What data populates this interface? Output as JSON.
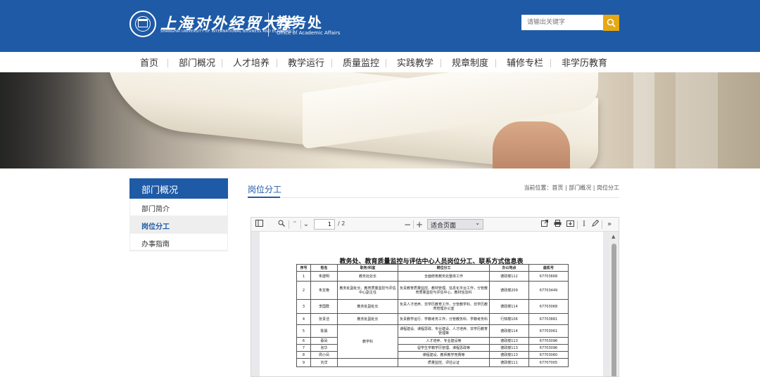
{
  "header": {
    "university_cn": "上海对外经贸大学",
    "university_en": "SHANGHAI UNIVERSITY OF INTERNATIONAL BUSINESS AND ECONOMICS",
    "office_cn": "教务处",
    "office_en": "Office of Academic Affairs",
    "search_placeholder": "请输出关键字"
  },
  "nav": [
    "首页",
    "部门概况",
    "人才培养",
    "教学运行",
    "质量监控",
    "实践教学",
    "规章制度",
    "辅修专栏",
    "非学历教育"
  ],
  "sidebar": {
    "title": "部门概况",
    "items": [
      {
        "label": "部门简介",
        "active": false
      },
      {
        "label": "岗位分工",
        "active": true
      },
      {
        "label": "办事指南",
        "active": false
      }
    ]
  },
  "content": {
    "title": "岗位分工",
    "breadcrumb": "当前位置：首页 | 部门概况 | 岗位分工"
  },
  "pdf_viewer": {
    "current_page": "1",
    "total_pages": "/ 2",
    "zoom": "适合页面",
    "document": {
      "title": "教务处、教育质量监控与评估中心人员岗位分工、联系方式信息表",
      "headers": [
        "序号",
        "姓名",
        "职务/科室",
        "岗位分工",
        "办公地点",
        "座机号"
      ],
      "rows": [
        [
          "1",
          "朱建明",
          "教务处处长",
          "全面统筹教务处整体工作",
          "德政楼112",
          "67703668"
        ],
        [
          "2",
          "朱龙艳",
          "教务处副处长、教育质量监控与评估中心副主任",
          "负责教育质量监控、教材管理、信息化平台工作，分管教育质量监控与评估中心、教材信息科",
          "德政楼209",
          "67703449"
        ],
        [
          "3",
          "李国群",
          "教务处副处长",
          "负责人才培养、非学历教育工作，分管教学科、非学历教育管理办公室",
          "德政楼114",
          "67703068"
        ],
        [
          "4",
          "张贵洁",
          "教务处副处长",
          "负责教学运行、学籍考务工作，分管教务科、学籍考务科",
          "行知楼106",
          "67703881"
        ],
        [
          "5",
          "陈晨",
          "教学科",
          "课程建设、课程思政、专业建设、人才培养、非学历教育管理等",
          "德政楼114",
          "67703061"
        ],
        [
          "6",
          "蔡凤",
          "教学科",
          "人才培养、专业建设等",
          "德政楼113",
          "67703096"
        ],
        [
          "7",
          "张华",
          "教学科",
          "留学生学籍学历管理、课程思政等",
          "德政楼113",
          "67703096"
        ],
        [
          "8",
          "周小凤",
          "教学科",
          "课程建设、教师教学竞赛等",
          "德政楼113",
          "67703060"
        ],
        [
          "9",
          "刘洋",
          "",
          "质量监控、评估认证",
          "德政楼111",
          "67707005"
        ]
      ]
    }
  }
}
